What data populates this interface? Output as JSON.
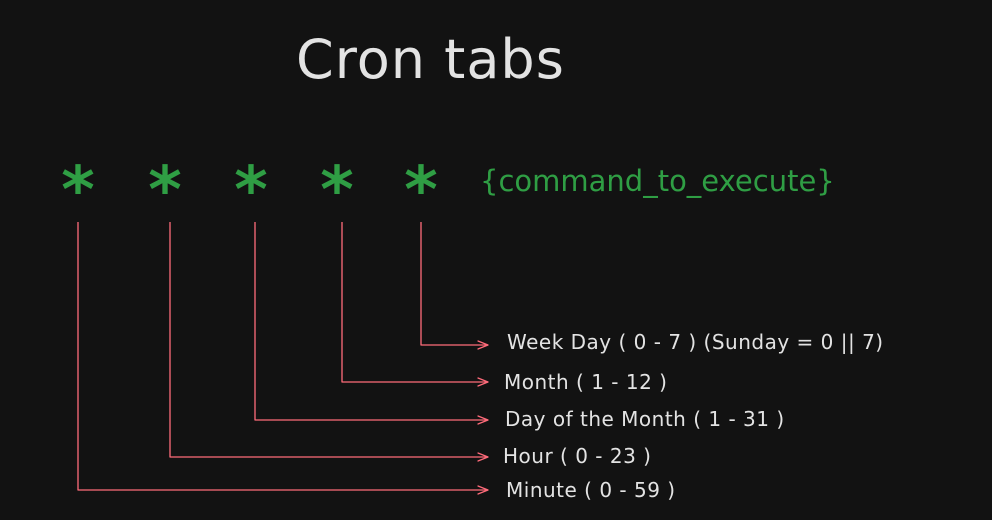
{
  "title": "Cron tabs",
  "asterisk_symbol": "*",
  "command": "{command_to_execute}",
  "fields": [
    {
      "label": "Minute ( 0 - 59 )"
    },
    {
      "label": "Hour ( 0 - 23 )"
    },
    {
      "label": "Day of the Month ( 1 - 31 )"
    },
    {
      "label": "Month ( 1 - 12 )"
    },
    {
      "label": "Week Day ( 0 - 7 ) (Sunday = 0 || 7)"
    }
  ],
  "colors": {
    "background": "#121212",
    "text": "#e3e3e3",
    "asterisk": "#2f9e44",
    "command": "#2f9e44",
    "connector": "#ff6b7a"
  }
}
